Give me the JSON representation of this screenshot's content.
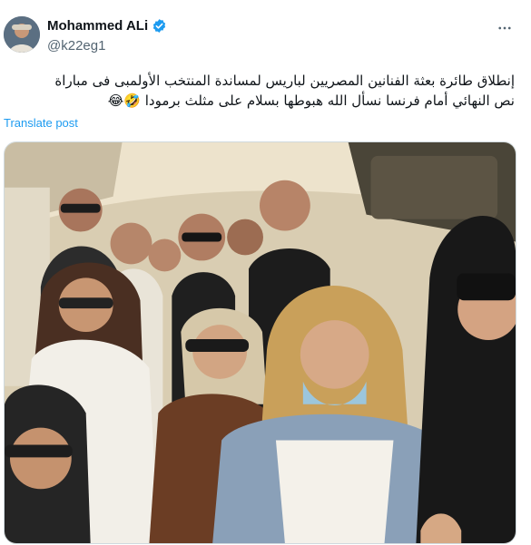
{
  "author": {
    "display_name": "Mohammed ALi",
    "handle": "@k22eg1",
    "verified": true,
    "avatar_icon": "user-avatar-photo"
  },
  "tweet": {
    "line1": "إنطلاق طائرة بعثة الفنانين المصريين لباريس لمساندة المنتخب الأولمبى فى مباراة",
    "line2": "نص النهائي أمام فرنسا نسأل الله هبوطها بسلام على مثلث برمودا",
    "emojis": "🤣😂",
    "translate_label": "Translate post"
  },
  "media": {
    "type": "photo",
    "subject": "group-selfie-airplane-cabin"
  },
  "colors": {
    "link": "#1d9bf0",
    "verified_badge": "#1d9bf0",
    "secondary_text": "#536471"
  },
  "icons": {
    "more": "more-horizontal-icon",
    "verified": "verified-badge-icon"
  }
}
